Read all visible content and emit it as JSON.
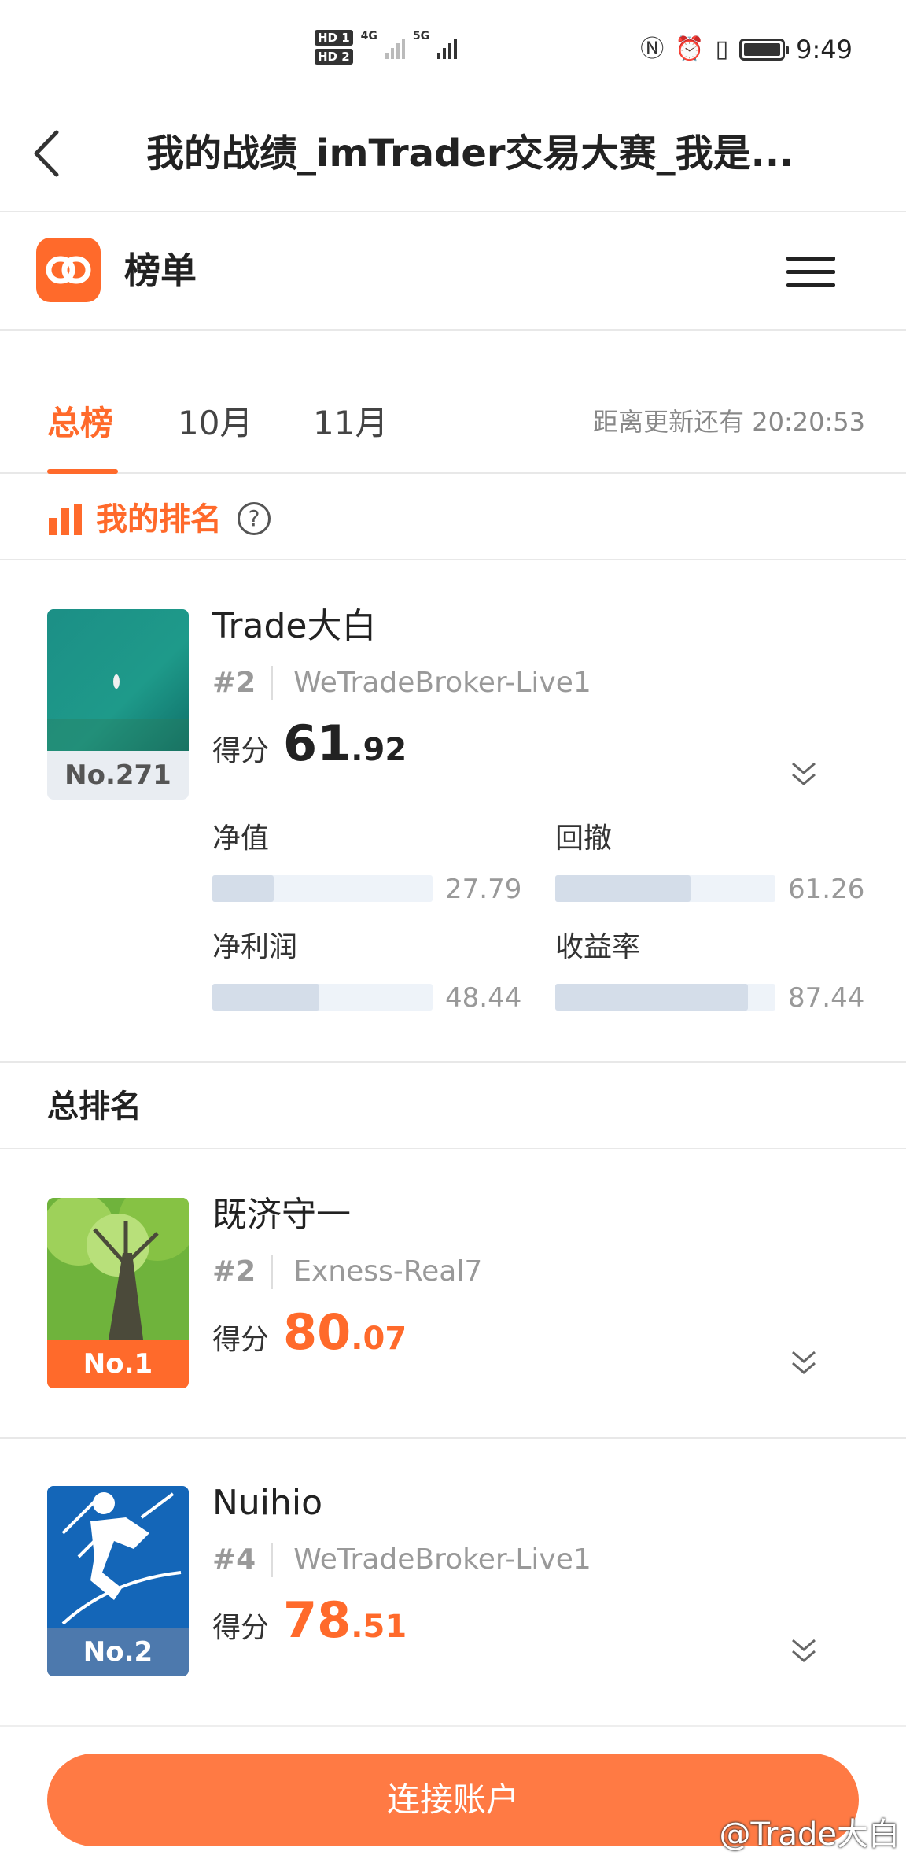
{
  "status_bar": {
    "sim1": "HD 1",
    "sim2": "HD 2",
    "net1": "4G",
    "net2": "5G",
    "time": "9:49"
  },
  "header": {
    "title": "我的战绩_imTrader交易大赛_我是..."
  },
  "app_bar": {
    "name": "榜单"
  },
  "tabs": [
    {
      "label": "总榜",
      "active": true
    },
    {
      "label": "10月",
      "active": false
    },
    {
      "label": "11月",
      "active": false
    }
  ],
  "update_timer": "距离更新还有 20:20:53",
  "my_ranking": {
    "title": "我的排名",
    "help": "?",
    "entry": {
      "rank_tag": "No.271",
      "name": "Trade大白",
      "number": "#2",
      "broker": "WeTradeBroker-Live1",
      "score_label": "得分",
      "score_int": "61",
      "score_dec": ".92",
      "metrics": [
        {
          "label": "净值",
          "value": "27.79",
          "fraction": 0.2779
        },
        {
          "label": "回撤",
          "value": "61.26",
          "fraction": 0.6126
        },
        {
          "label": "净利润",
          "value": "48.44",
          "fraction": 0.4844
        },
        {
          "label": "收益率",
          "value": "87.44",
          "fraction": 0.8744
        }
      ]
    }
  },
  "overall": {
    "title": "总排名",
    "entries": [
      {
        "rank_tag": "No.1",
        "name": "既济守一",
        "number": "#2",
        "broker": "Exness-Real7",
        "score_label": "得分",
        "score_int": "80",
        "score_dec": ".07"
      },
      {
        "rank_tag": "No.2",
        "name": "Nuihio",
        "number": "#4",
        "broker": "WeTradeBroker-Live1",
        "score_label": "得分",
        "score_int": "78",
        "score_dec": ".51"
      }
    ]
  },
  "bottom": {
    "connect_label": "连接账户",
    "watermark": "@Trade大白"
  },
  "colors": {
    "accent": "#ff6a2b",
    "button": "#ff7a44",
    "rank1": "#ff6a2b",
    "rank2": "#4d79ad",
    "rank_other": "#e9edf2"
  }
}
